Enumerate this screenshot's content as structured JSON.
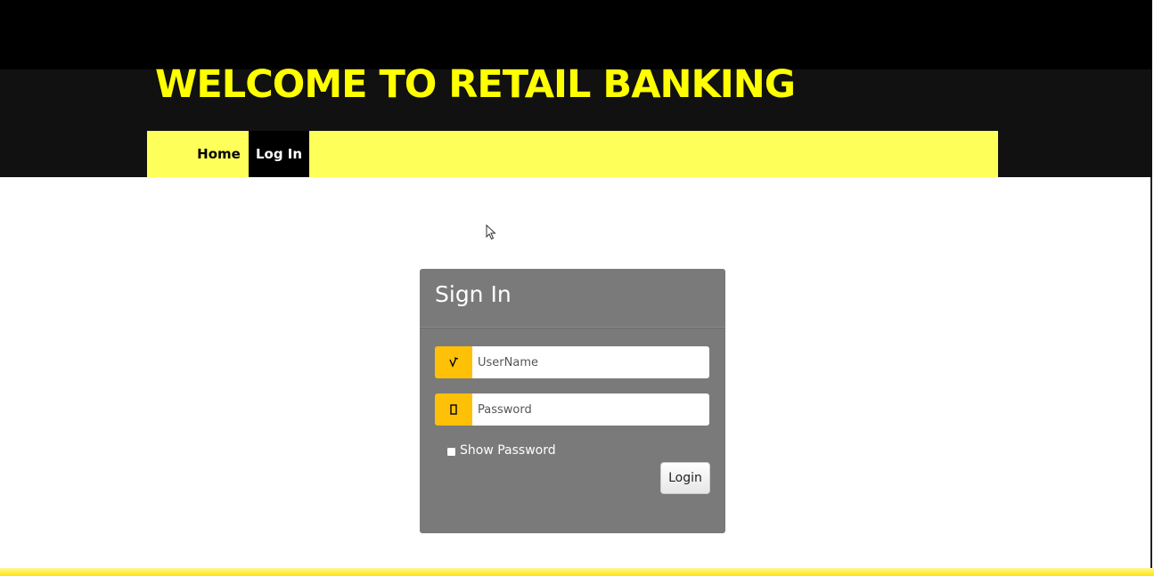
{
  "header": {
    "title": "WELCOME TO RETAIL BANKING"
  },
  "nav": {
    "items": [
      {
        "label": "Home",
        "active": false
      },
      {
        "label": "Log In",
        "active": true
      }
    ]
  },
  "signin": {
    "title": "Sign In",
    "username": {
      "icon": "user-icon",
      "value": "",
      "placeholder": "UserName"
    },
    "password": {
      "icon": "lock-icon",
      "value": "",
      "placeholder": "Password"
    },
    "show_password": {
      "label": "Show Password",
      "checked": false
    },
    "login_label": "Login"
  },
  "colors": {
    "title": "#ffff00",
    "navbar": "#ffff5a",
    "addon": "#ffc107",
    "panel": "#7a7a7a"
  }
}
